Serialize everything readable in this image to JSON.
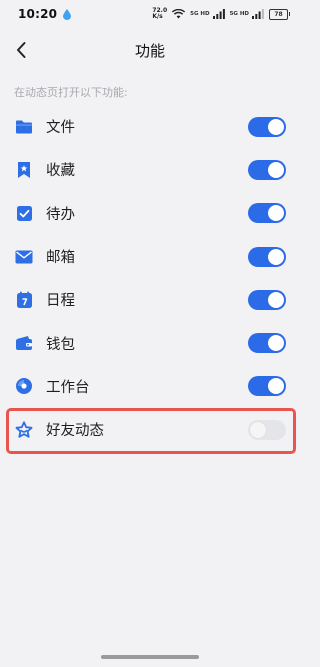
{
  "status_bar": {
    "time": "10:20",
    "speed_value": "72.0",
    "speed_unit": "K/s",
    "signal_label_1": "5G HD",
    "signal_label_2": "5G HD",
    "battery_level": "78"
  },
  "header": {
    "title": "功能",
    "back_icon": "chevron-left-icon"
  },
  "section_hint": "在动态页打开以下功能:",
  "items": [
    {
      "label": "文件",
      "icon": "folder-icon",
      "enabled": true
    },
    {
      "label": "收藏",
      "icon": "bookmark-icon",
      "enabled": true
    },
    {
      "label": "待办",
      "icon": "todo-check-icon",
      "enabled": true
    },
    {
      "label": "邮箱",
      "icon": "mail-icon",
      "enabled": true
    },
    {
      "label": "日程",
      "icon": "calendar-icon",
      "enabled": true
    },
    {
      "label": "钱包",
      "icon": "wallet-icon",
      "enabled": true
    },
    {
      "label": "工作台",
      "icon": "workbench-icon",
      "enabled": true
    },
    {
      "label": "好友动态",
      "icon": "friend-star-icon",
      "enabled": false
    }
  ],
  "colors": {
    "accent": "#2c6be8",
    "icon_blue": "#2f6fe6",
    "highlight_border": "#e8554f",
    "background": "#f2f2f4"
  }
}
